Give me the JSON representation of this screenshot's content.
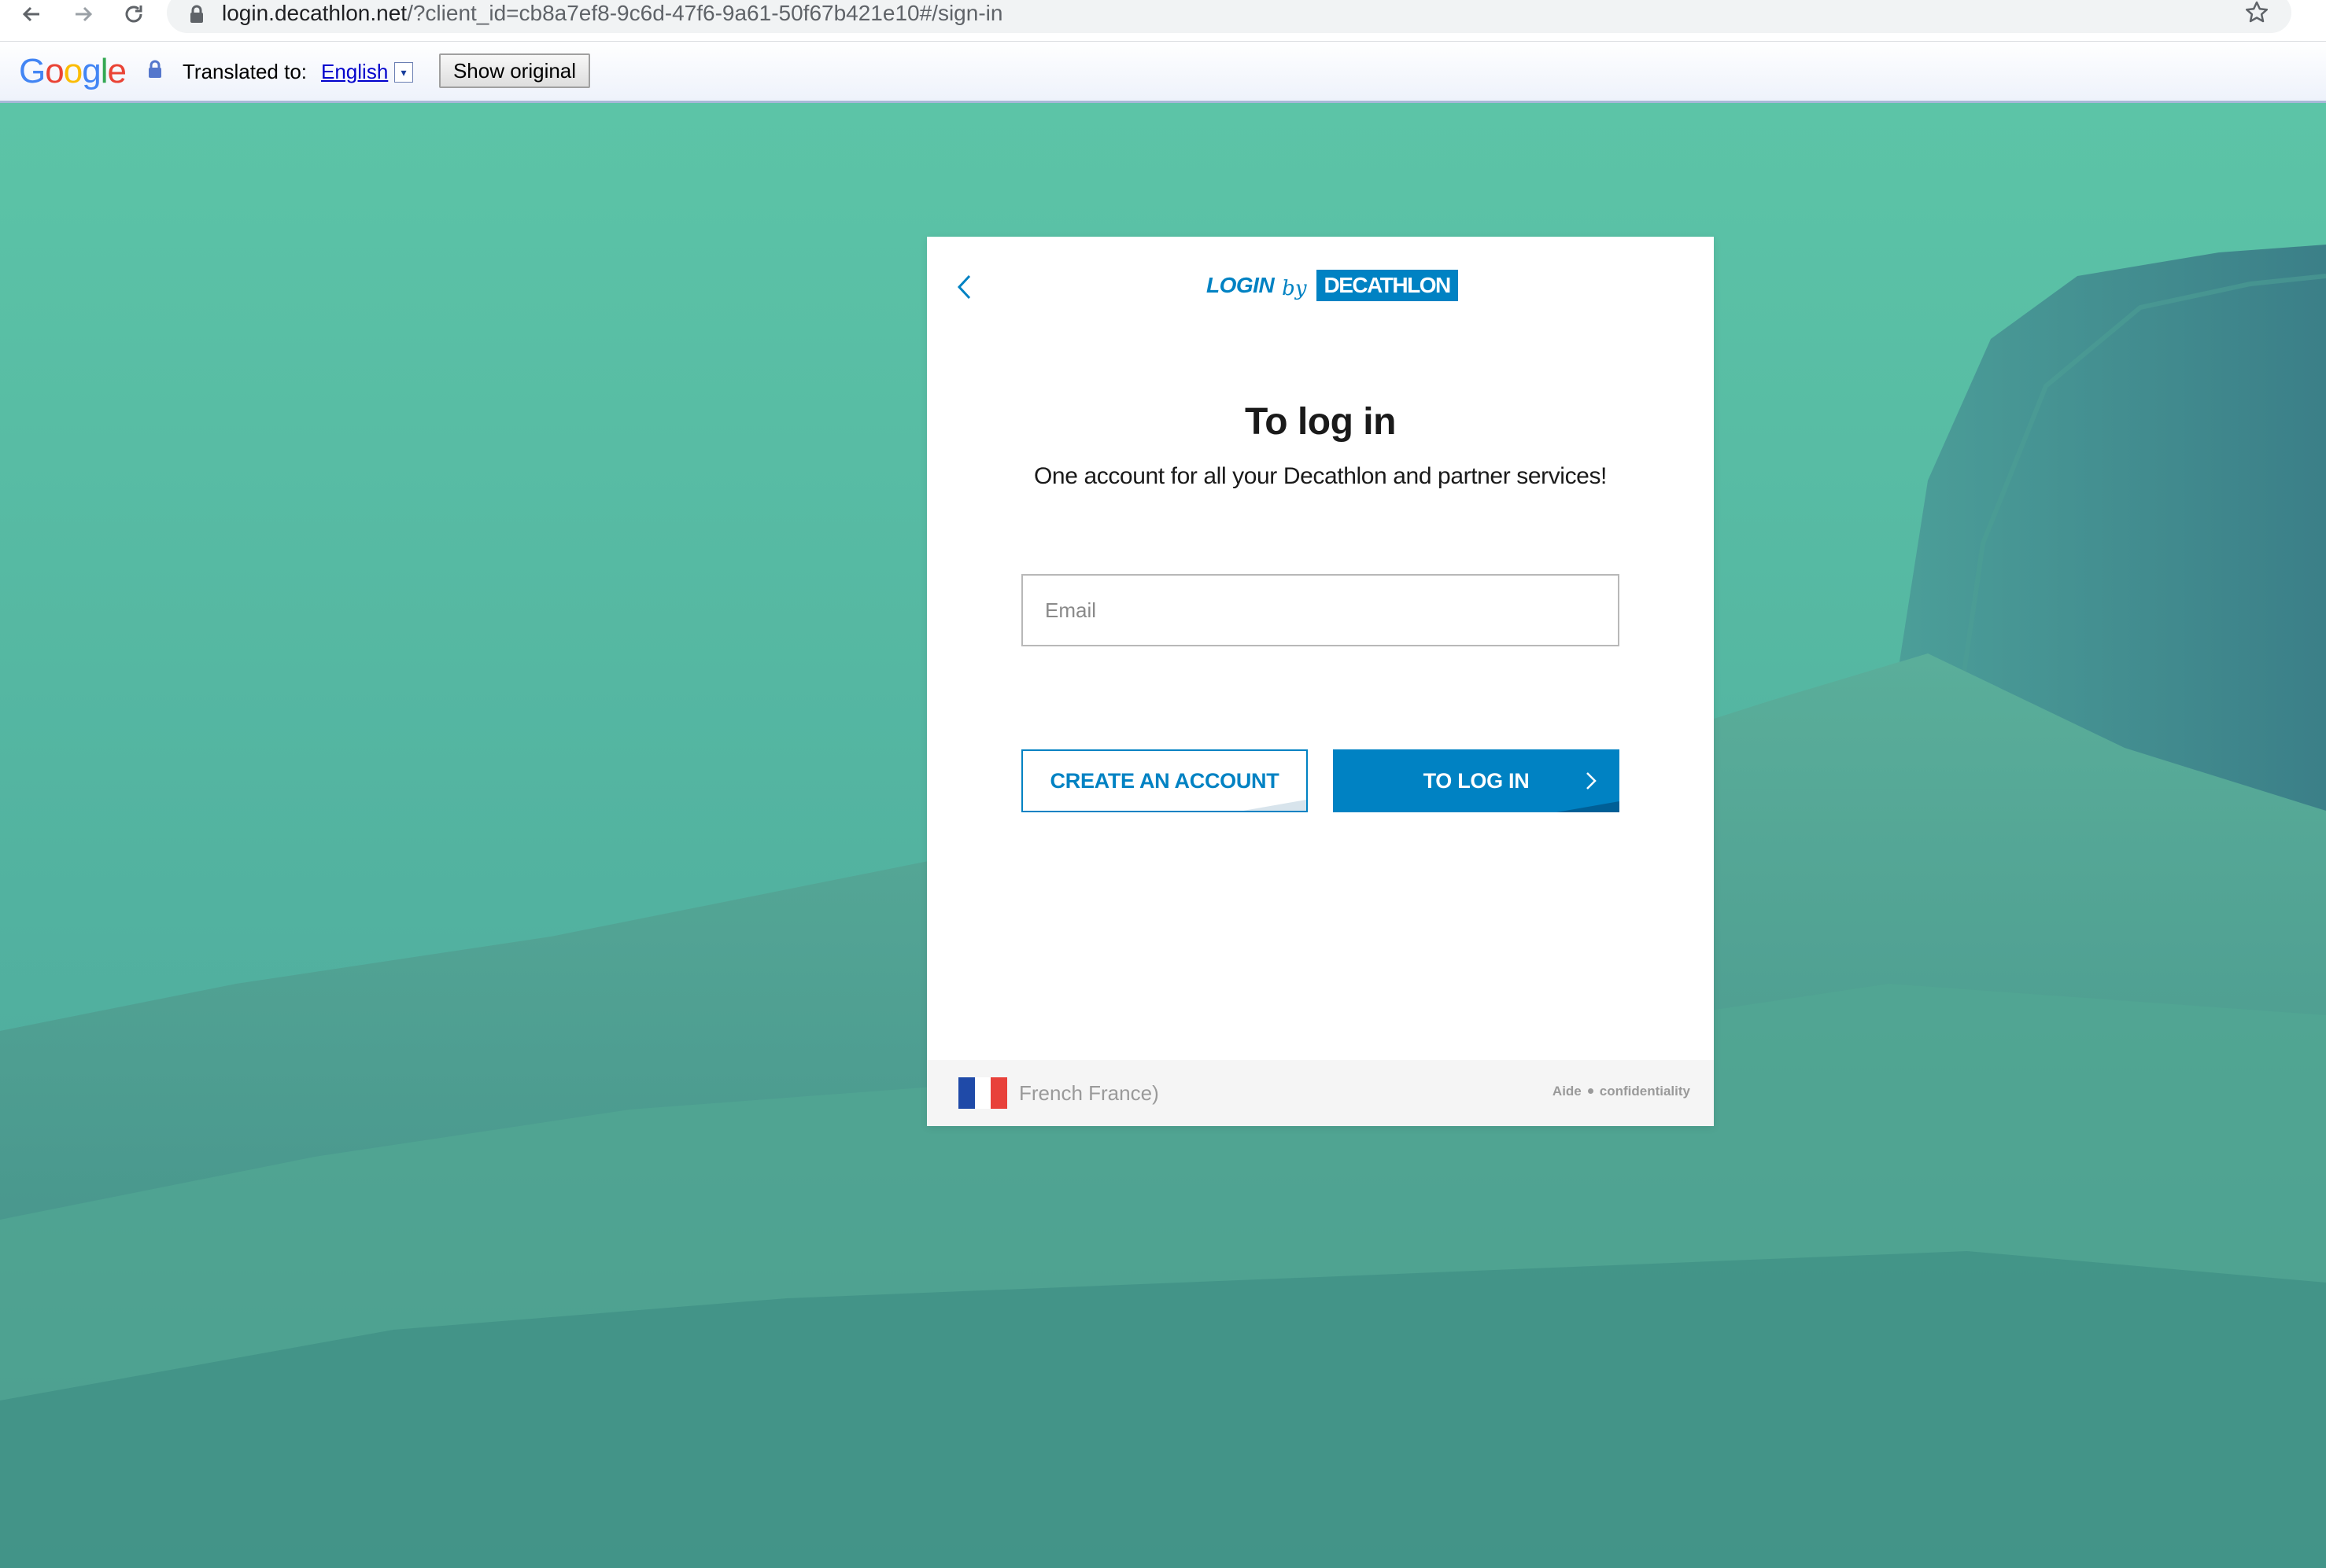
{
  "browser": {
    "url_host": "login.decathlon.net",
    "url_rest": "/?client_id=cb8a7ef8-9c6d-47f6-9a61-50f67b421e10#/sign-in",
    "icons": [
      "back-arrow-icon",
      "forward-arrow-icon",
      "reload-icon",
      "lock-icon",
      "star-icon"
    ]
  },
  "translate_bar": {
    "logo": "Google",
    "label": "Translated to:",
    "language": "English",
    "dropdown_glyph": "▾",
    "show_original_label": "Show original"
  },
  "card": {
    "brand": {
      "login": "LOGIN",
      "by": "by",
      "company": "DECATHLON",
      "color": "#0082c3"
    },
    "title": "To log in",
    "subtitle": "One account for all your Decathlon and partner services!",
    "email_placeholder": "Email",
    "create_account_label": "CREATE AN ACCOUNT",
    "login_label": "TO LOG IN",
    "footer": {
      "locale": "French France)",
      "help": "Aide",
      "privacy": "confidentiality",
      "flag_colors": [
        "#1f4aa8",
        "#ffffff",
        "#e8413a"
      ]
    }
  }
}
